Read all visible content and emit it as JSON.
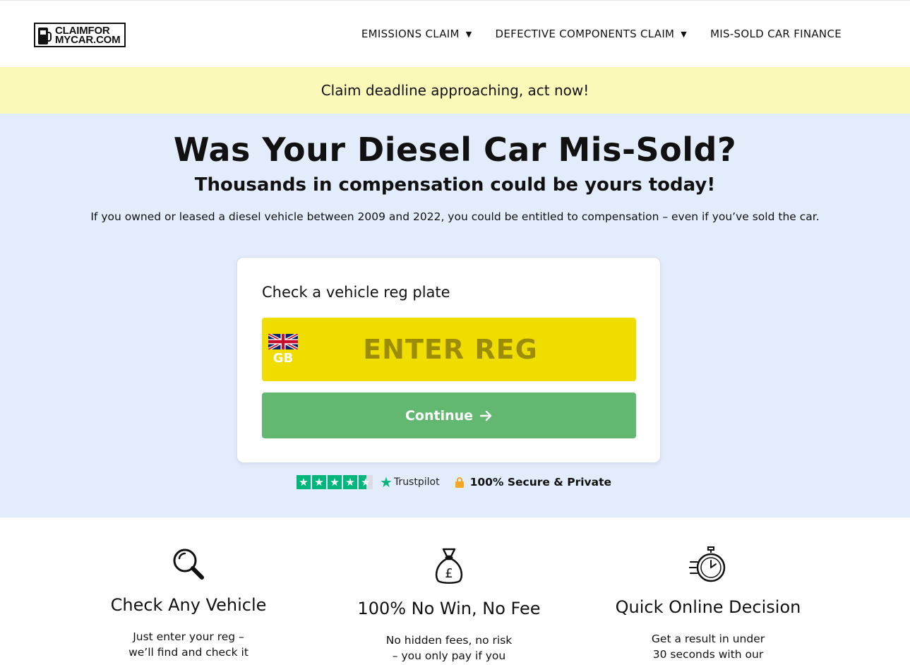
{
  "header": {
    "logo": {
      "line1": "CLAIMFOR",
      "line2": "MYCAR.COM"
    },
    "nav": [
      {
        "label": "EMISSIONS CLAIM",
        "has_dropdown": true
      },
      {
        "label": "DEFECTIVE COMPONENTS CLAIM",
        "has_dropdown": true
      },
      {
        "label": "MIS-SOLD CAR FINANCE",
        "has_dropdown": false
      }
    ]
  },
  "banner": {
    "text": "Claim deadline approaching, act now!"
  },
  "hero": {
    "title": "Was Your Diesel Car Mis-Sold?",
    "subtitle": "Thousands in compensation could be yours today!",
    "description": "If you owned or leased a diesel vehicle between 2009 and 2022, you could be entitled to compensation – even if you’ve sold the car."
  },
  "reg_check": {
    "title": "Check a vehicle reg plate",
    "country_code": "GB",
    "placeholder": "ENTER REG",
    "value": "",
    "continue_label": "Continue",
    "continue_icon": "arrow-right-icon"
  },
  "trust": {
    "rating_stars": 4.5,
    "trustpilot_label": "Trustpilot",
    "secure_label": "100% Secure & Private"
  },
  "features": [
    {
      "icon": "magnifier-icon",
      "title": "Check Any Vehicle",
      "description_lines": [
        "Just enter your reg –",
        "we’ll find and check it"
      ]
    },
    {
      "icon": "money-bag-icon",
      "title": "100% No Win, No Fee",
      "description_lines": [
        "No hidden fees, no risk",
        "– you only pay if you"
      ]
    },
    {
      "icon": "stopwatch-icon",
      "title": "Quick Online Decision",
      "description_lines": [
        "Get a result in under",
        "30 seconds with our"
      ]
    }
  ],
  "colors": {
    "banner_bg": "#fbf9b8",
    "hero_bg": "#e3ecfa",
    "plate_yellow": "#f0dd00",
    "plate_blue": "#2f5aa8",
    "continue_green": "#63b871",
    "trustpilot_green": "#00b67a",
    "lock_orange": "#f5a623"
  }
}
